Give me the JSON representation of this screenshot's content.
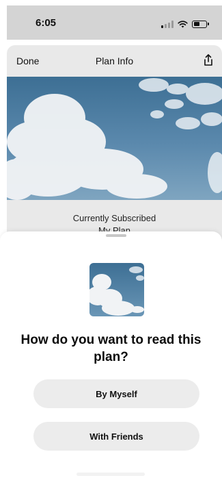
{
  "status_bar": {
    "time": "6:05"
  },
  "nav": {
    "done_label": "Done",
    "title": "Plan Info"
  },
  "plan": {
    "status": "Currently Subscribed",
    "name_partial": "My Plan"
  },
  "sheet": {
    "question": "How do you want to read this plan?",
    "options": [
      "By Myself",
      "With Friends"
    ]
  },
  "colors": {
    "sky": "#4a7ea6",
    "button_bg": "#ececec",
    "sheet_bg": "#ffffff"
  }
}
